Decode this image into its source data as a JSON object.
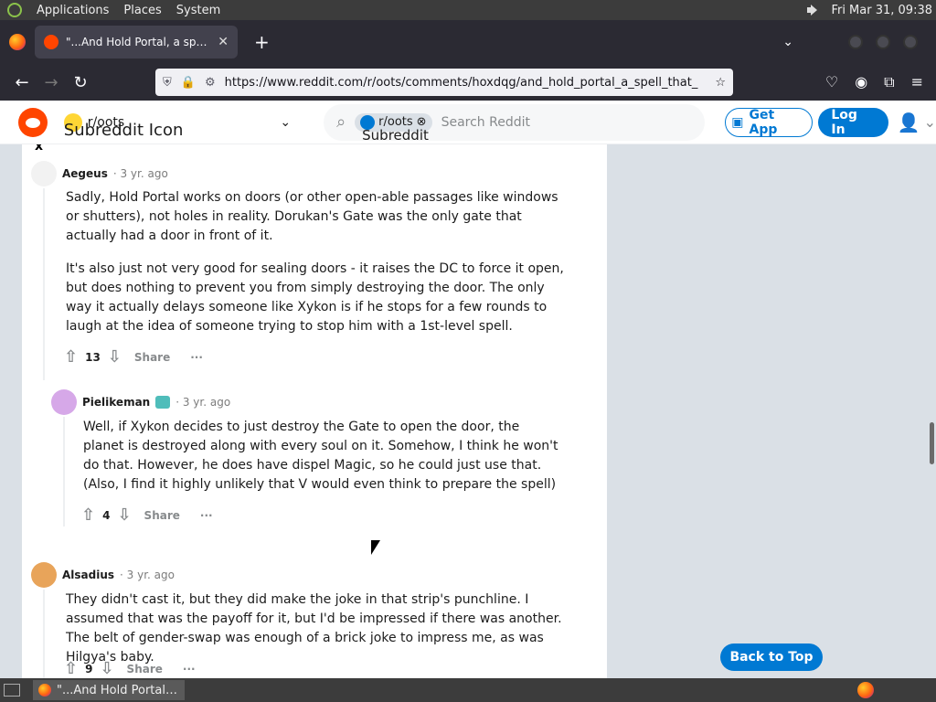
{
  "system": {
    "menu": [
      "Applications",
      "Places",
      "System"
    ],
    "datetime": "Fri Mar 31, 09:38"
  },
  "browser": {
    "tab_title": "\"...And Hold Portal, a spell th",
    "url": "https://www.reddit.com/r/oots/comments/hoxdqg/and_hold_portal_a_spell_that_",
    "new_tab": "+"
  },
  "reddit_header": {
    "subreddit": "r/oots",
    "subreddit_icon_alt": "Subreddit Icon",
    "search_pill": "r/oots",
    "search_pill_icon_alt": "Subreddit Icon",
    "search_placeholder": "Search Reddit",
    "get_app": "Get App",
    "login": "Log In"
  },
  "comments": [
    {
      "author": "Aegeus",
      "meta": "· 3 yr. ago",
      "paragraphs": [
        "Sadly, Hold Portal works on doors (or other open-able passages like windows or shutters), not holes in reality. Dorukan's Gate was the only gate that actually had a door in front of it.",
        "It's also just not very good for sealing doors - it raises the DC to force it open, but does nothing to prevent you from simply destroying the door. The only way it actually delays someone like Xykon is if he stops for a few rounds to laugh at the idea of someone trying to stop him with a 1st-level spell."
      ],
      "votes": "13",
      "share": "Share",
      "more": "···"
    },
    {
      "author": "Pielikeman",
      "meta": "· 3 yr. ago",
      "paragraphs": [
        "Well, if Xykon decides to just destroy the Gate to open the door, the planet is destroyed along with every soul on it. Somehow, I think he won't do that. However, he does have dispel Magic, so he could just use that. (Also, I find it highly unlikely that V would even think to prepare the spell)"
      ],
      "votes": "4",
      "share": "Share",
      "more": "···"
    },
    {
      "author": "Alsadius",
      "meta": "· 3 yr. ago",
      "paragraphs": [
        "They didn't cast it, but they did make the joke in that strip's punchline. I assumed that was the payoff for it, but I'd be impressed if there was another. The belt of gender-swap was enough of a brick joke to impress me, as was Hilgya's baby."
      ],
      "votes": "9",
      "share": "Share",
      "more": "···"
    }
  ],
  "back_to_top": "Back to Top",
  "taskbar": {
    "window_title": "\"...And Hold Portal, ..."
  },
  "colors": {
    "reddit_orange": "#ff4500",
    "reddit_blue": "#0079d3"
  }
}
